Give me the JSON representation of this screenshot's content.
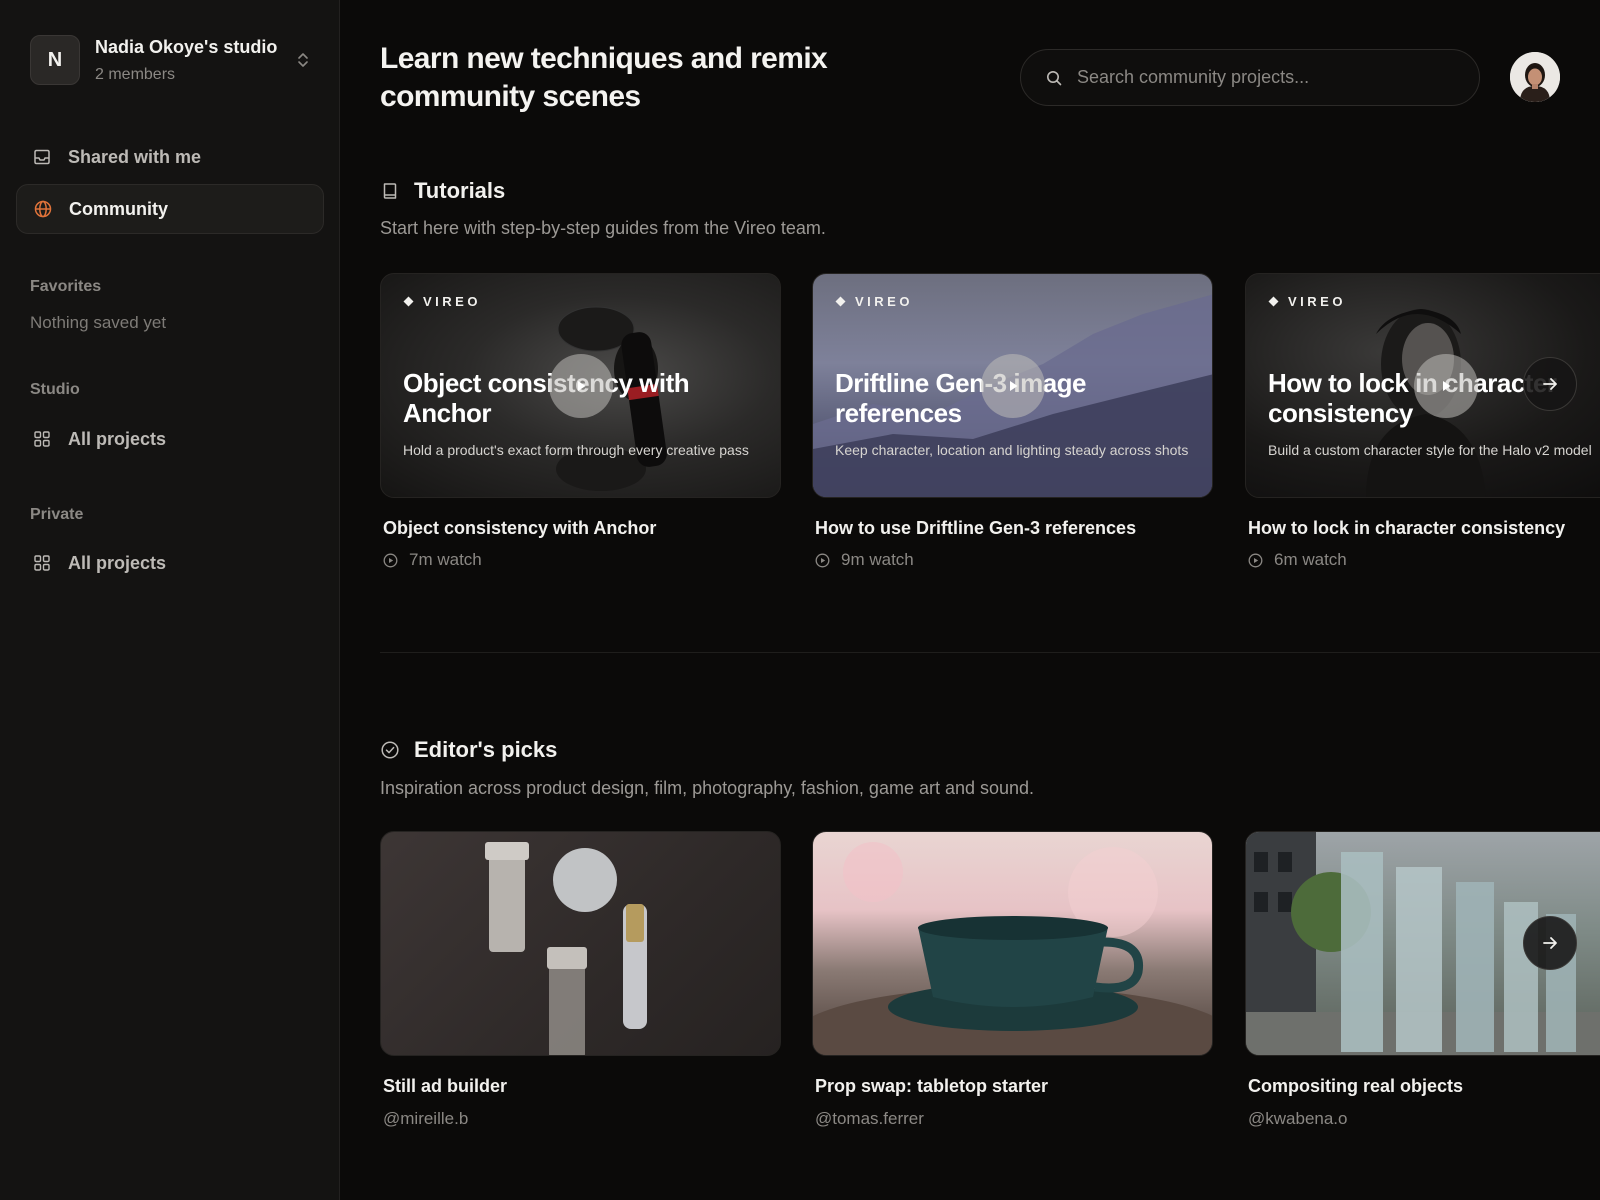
{
  "workspace": {
    "initial": "N",
    "name": "Nadia Okoye's studio",
    "members": "2 members"
  },
  "sidebar": {
    "shared_label": "Shared with me",
    "community_label": "Community",
    "favorites": {
      "label": "Favorites",
      "empty": "Nothing saved yet"
    },
    "studio": {
      "label": "Studio",
      "item": "All projects"
    },
    "private": {
      "label": "Private",
      "item": "All projects"
    }
  },
  "header": {
    "headline": "Learn new techniques and remix community scenes",
    "search_placeholder": "Search community projects..."
  },
  "tutorials": {
    "title": "Tutorials",
    "subtitle": "Start here with step-by-step guides from the Vireo team.",
    "cards": [
      {
        "brand": "VIREO",
        "overlay_title": "Object consistency with Anchor",
        "overlay_desc": "Hold a product's exact form through every creative pass",
        "title": "Object consistency with Anchor",
        "meta": "7m watch"
      },
      {
        "brand": "VIREO",
        "overlay_title": "Driftline Gen-3 image references",
        "overlay_desc": "Keep character, location and lighting steady across shots",
        "title": "How to use Driftline Gen-3 references",
        "meta": "9m watch"
      },
      {
        "brand": "VIREO",
        "overlay_title": "How to lock in character consistency",
        "overlay_desc": "Build a custom character style for the Halo v2 model",
        "title": "How to lock in character consistency",
        "meta": "6m watch"
      }
    ]
  },
  "picks": {
    "title": "Editor's picks",
    "subtitle": "Inspiration across product design, film, photography, fashion, game art and sound.",
    "cards": [
      {
        "title": "Still ad builder",
        "author": "@mireille.b"
      },
      {
        "title": "Prop swap: tabletop starter",
        "author": "@tomas.ferrer"
      },
      {
        "title": "Compositing real objects",
        "author": "@kwabena.o"
      }
    ]
  },
  "colors": {
    "accent": "#e0733a",
    "background": "#0b0a09",
    "sidebar": "#141312"
  },
  "icons": {
    "shared": "inbox-icon",
    "community": "globe-icon",
    "projects": "grid-icon",
    "tutorials": "book-icon",
    "picks": "check-circle-icon",
    "play": "play-icon",
    "next": "arrow-right-icon",
    "search": "search-icon",
    "watch": "play-circle-icon",
    "brand": "diamond-icon",
    "switcher": "chevron-updown-icon"
  }
}
